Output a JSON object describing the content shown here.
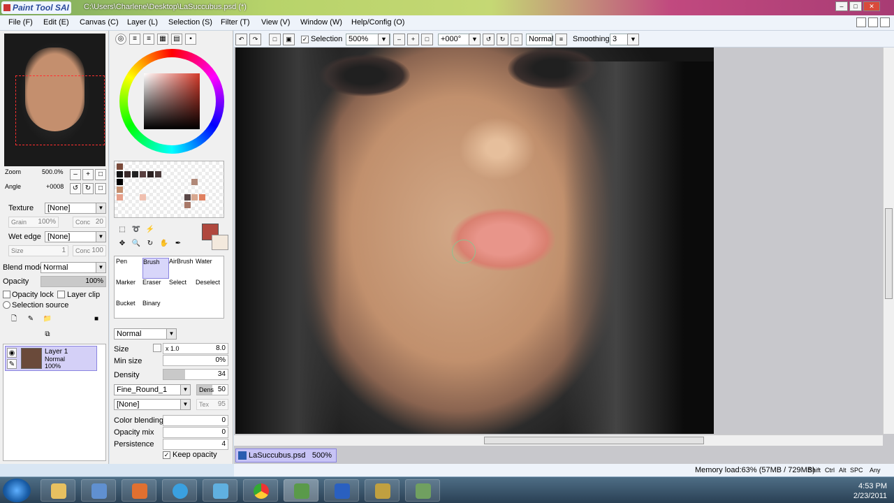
{
  "window": {
    "app_name": "Paint Tool SAI",
    "title": "C:\\Users\\Charlene\\Desktop\\LaSuccubus.psd (*)"
  },
  "menu": [
    "File (F)",
    "Edit (E)",
    "Canvas (C)",
    "Layer (L)",
    "Selection (S)",
    "Filter (T)",
    "View (V)",
    "Window (W)",
    "Help/Config (O)"
  ],
  "navigator": {
    "zoom_label": "Zoom",
    "zoom_value": "500.0%",
    "angle_label": "Angle",
    "angle_value": "+0008"
  },
  "texture": {
    "label": "Texture",
    "value": "[None]",
    "grain": "Grain",
    "grain_val": "100%",
    "conc": "Conc",
    "conc_val": "20"
  },
  "wet_edge": {
    "label": "Wet edge",
    "value": "[None]",
    "size": "Size",
    "size_val": "1",
    "conc": "Conc",
    "conc_val": "100"
  },
  "blend": {
    "label": "Blend mode",
    "value": "Normal"
  },
  "opacity": {
    "label": "Opacity",
    "value": "100%",
    "level": 1.0
  },
  "checks": {
    "opacity_lock": "Opacity lock",
    "layer_clip": "Layer clip",
    "selection_source": "Selection source"
  },
  "layer": {
    "name": "Layer 1",
    "mode": "Normal",
    "opacity": "100%"
  },
  "colors": {
    "primary": "#b0483e",
    "secondary": "#f3e9dd"
  },
  "tools": [
    {
      "label": "Pen"
    },
    {
      "label": "Brush"
    },
    {
      "label": "AirBrush"
    },
    {
      "label": "Water"
    },
    {
      "label": "Marker"
    },
    {
      "label": "Eraser"
    },
    {
      "label": "Select"
    },
    {
      "label": "Deselect"
    },
    {
      "label": "Bucket"
    },
    {
      "label": "Binary"
    }
  ],
  "brush": {
    "mode": "Normal",
    "size_label": "Size",
    "size_mult": "x 1.0",
    "size_val": "8.0",
    "minsize_label": "Min size",
    "minsize_val": "0%",
    "density_label": "Density",
    "density_val": "34",
    "shape": "Fine_Round_1",
    "dens_label": "Dens",
    "dens_val": "50",
    "texture": "[None]",
    "tex_label": "Tex",
    "tex_val": "95",
    "color_blending_label": "Color blending",
    "color_blending_val": "0",
    "opacity_mix_label": "Opacity mix",
    "opacity_mix_val": "0",
    "persistence_label": "Persistence",
    "persistence_val": "4",
    "keep_opacity": "Keep opacity"
  },
  "canvas_toolbar": {
    "selection": "Selection",
    "zoom": "500%",
    "angle": "+000°",
    "mode": "Normal",
    "smoothing_label": "Smoothing",
    "smoothing_val": "3"
  },
  "doc_tab": {
    "name": "LaSuccubus.psd",
    "zoom": "500%"
  },
  "status": {
    "memory": "Memory load:63% (57MB / 729MB)",
    "keys": [
      "Shift",
      "Ctrl",
      "Alt",
      "SPC",
      "Any"
    ]
  },
  "tray": {
    "time": "4:53 PM",
    "date": "2/23/2011"
  }
}
